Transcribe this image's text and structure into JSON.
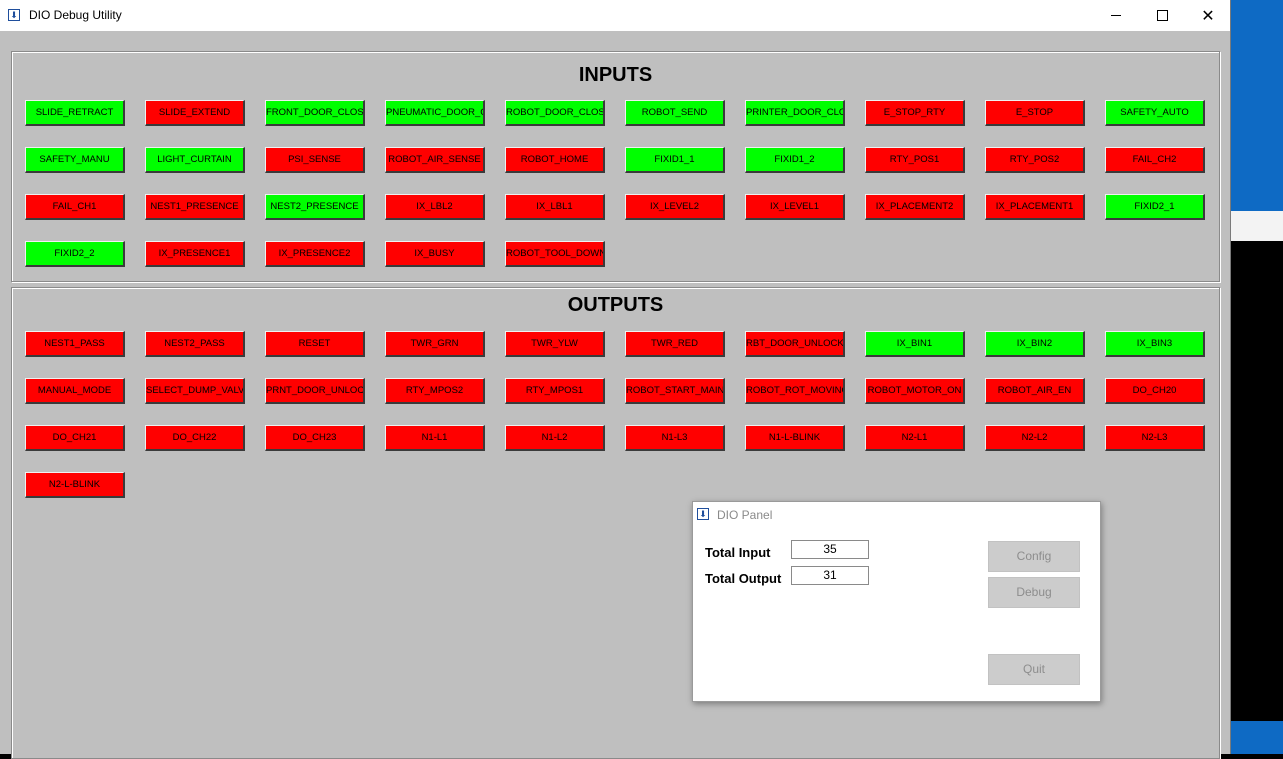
{
  "window": {
    "title": "DIO Debug Utility",
    "controls": {
      "minimize": "—",
      "maximize": "□",
      "close": "✕"
    }
  },
  "colors": {
    "on": "#00ff00",
    "off": "#ff0000"
  },
  "inputs": {
    "title": "INPUTS",
    "items": [
      {
        "label": "SLIDE_RETRACT",
        "state": "on"
      },
      {
        "label": "SLIDE_EXTEND",
        "state": "off"
      },
      {
        "label": "FRONT_DOOR_CLOSE",
        "state": "on"
      },
      {
        "label": "PNEUMATIC_DOOR_CLOSE",
        "state": "on"
      },
      {
        "label": "ROBOT_DOOR_CLOSE",
        "state": "on"
      },
      {
        "label": "ROBOT_SEND",
        "state": "on"
      },
      {
        "label": "PRINTER_DOOR_CLOSE",
        "state": "on"
      },
      {
        "label": "E_STOP_RTY",
        "state": "off"
      },
      {
        "label": "E_STOP",
        "state": "off"
      },
      {
        "label": "SAFETY_AUTO",
        "state": "on"
      },
      {
        "label": "SAFETY_MANU",
        "state": "on"
      },
      {
        "label": "LIGHT_CURTAIN",
        "state": "on"
      },
      {
        "label": "PSI_SENSE",
        "state": "off"
      },
      {
        "label": "ROBOT_AIR_SENSE",
        "state": "off"
      },
      {
        "label": "ROBOT_HOME",
        "state": "off"
      },
      {
        "label": "FIXID1_1",
        "state": "on"
      },
      {
        "label": "FIXID1_2",
        "state": "on"
      },
      {
        "label": "RTY_POS1",
        "state": "off"
      },
      {
        "label": "RTY_POS2",
        "state": "off"
      },
      {
        "label": "FAIL_CH2",
        "state": "off"
      },
      {
        "label": "FAIL_CH1",
        "state": "off"
      },
      {
        "label": "NEST1_PRESENCE",
        "state": "off"
      },
      {
        "label": "NEST2_PRESENCE",
        "state": "on"
      },
      {
        "label": "IX_LBL2",
        "state": "off"
      },
      {
        "label": "IX_LBL1",
        "state": "off"
      },
      {
        "label": "IX_LEVEL2",
        "state": "off"
      },
      {
        "label": "IX_LEVEL1",
        "state": "off"
      },
      {
        "label": "IX_PLACEMENT2",
        "state": "off"
      },
      {
        "label": "IX_PLACEMENT1",
        "state": "off"
      },
      {
        "label": "FIXID2_1",
        "state": "on"
      },
      {
        "label": "FIXID2_2",
        "state": "on"
      },
      {
        "label": "IX_PRESENCE1",
        "state": "off"
      },
      {
        "label": "IX_PRESENCE2",
        "state": "off"
      },
      {
        "label": "IX_BUSY",
        "state": "off"
      },
      {
        "label": "ROBOT_TOOL_DOWN",
        "state": "off"
      }
    ]
  },
  "outputs": {
    "title": "OUTPUTS",
    "items": [
      {
        "label": "NEST1_PASS",
        "state": "off"
      },
      {
        "label": "NEST2_PASS",
        "state": "off"
      },
      {
        "label": "RESET",
        "state": "off"
      },
      {
        "label": "TWR_GRN",
        "state": "off"
      },
      {
        "label": "TWR_YLW",
        "state": "off"
      },
      {
        "label": "TWR_RED",
        "state": "off"
      },
      {
        "label": "RBT_DOOR_UNLOCK",
        "state": "off"
      },
      {
        "label": "IX_BIN1",
        "state": "on"
      },
      {
        "label": "IX_BIN2",
        "state": "on"
      },
      {
        "label": "IX_BIN3",
        "state": "on"
      },
      {
        "label": "MANUAL_MODE",
        "state": "off"
      },
      {
        "label": "SELECT_DUMP_VALVE",
        "state": "off"
      },
      {
        "label": "PRNT_DOOR_UNLOCK",
        "state": "off"
      },
      {
        "label": "RTY_MPOS2",
        "state": "off"
      },
      {
        "label": "RTY_MPOS1",
        "state": "off"
      },
      {
        "label": "ROBOT_START_MAIN",
        "state": "off"
      },
      {
        "label": "ROBOT_ROT_MOVING",
        "state": "off"
      },
      {
        "label": "ROBOT_MOTOR_ON",
        "state": "off"
      },
      {
        "label": "ROBOT_AIR_EN",
        "state": "off"
      },
      {
        "label": "DO_CH20",
        "state": "off"
      },
      {
        "label": "DO_CH21",
        "state": "off"
      },
      {
        "label": "DO_CH22",
        "state": "off"
      },
      {
        "label": "DO_CH23",
        "state": "off"
      },
      {
        "label": "N1-L1",
        "state": "off"
      },
      {
        "label": "N1-L2",
        "state": "off"
      },
      {
        "label": "N1-L3",
        "state": "off"
      },
      {
        "label": "N1-L-BLINK",
        "state": "off"
      },
      {
        "label": "N2-L1",
        "state": "off"
      },
      {
        "label": "N2-L2",
        "state": "off"
      },
      {
        "label": "N2-L3",
        "state": "off"
      },
      {
        "label": "N2-L-BLINK",
        "state": "off"
      }
    ]
  },
  "dio_panel": {
    "title": "DIO Panel",
    "total_input_label": "Total Input",
    "total_input_value": "35",
    "total_output_label": "Total Output",
    "total_output_value": "31",
    "config_label": "Config",
    "debug_label": "Debug",
    "quit_label": "Quit"
  }
}
